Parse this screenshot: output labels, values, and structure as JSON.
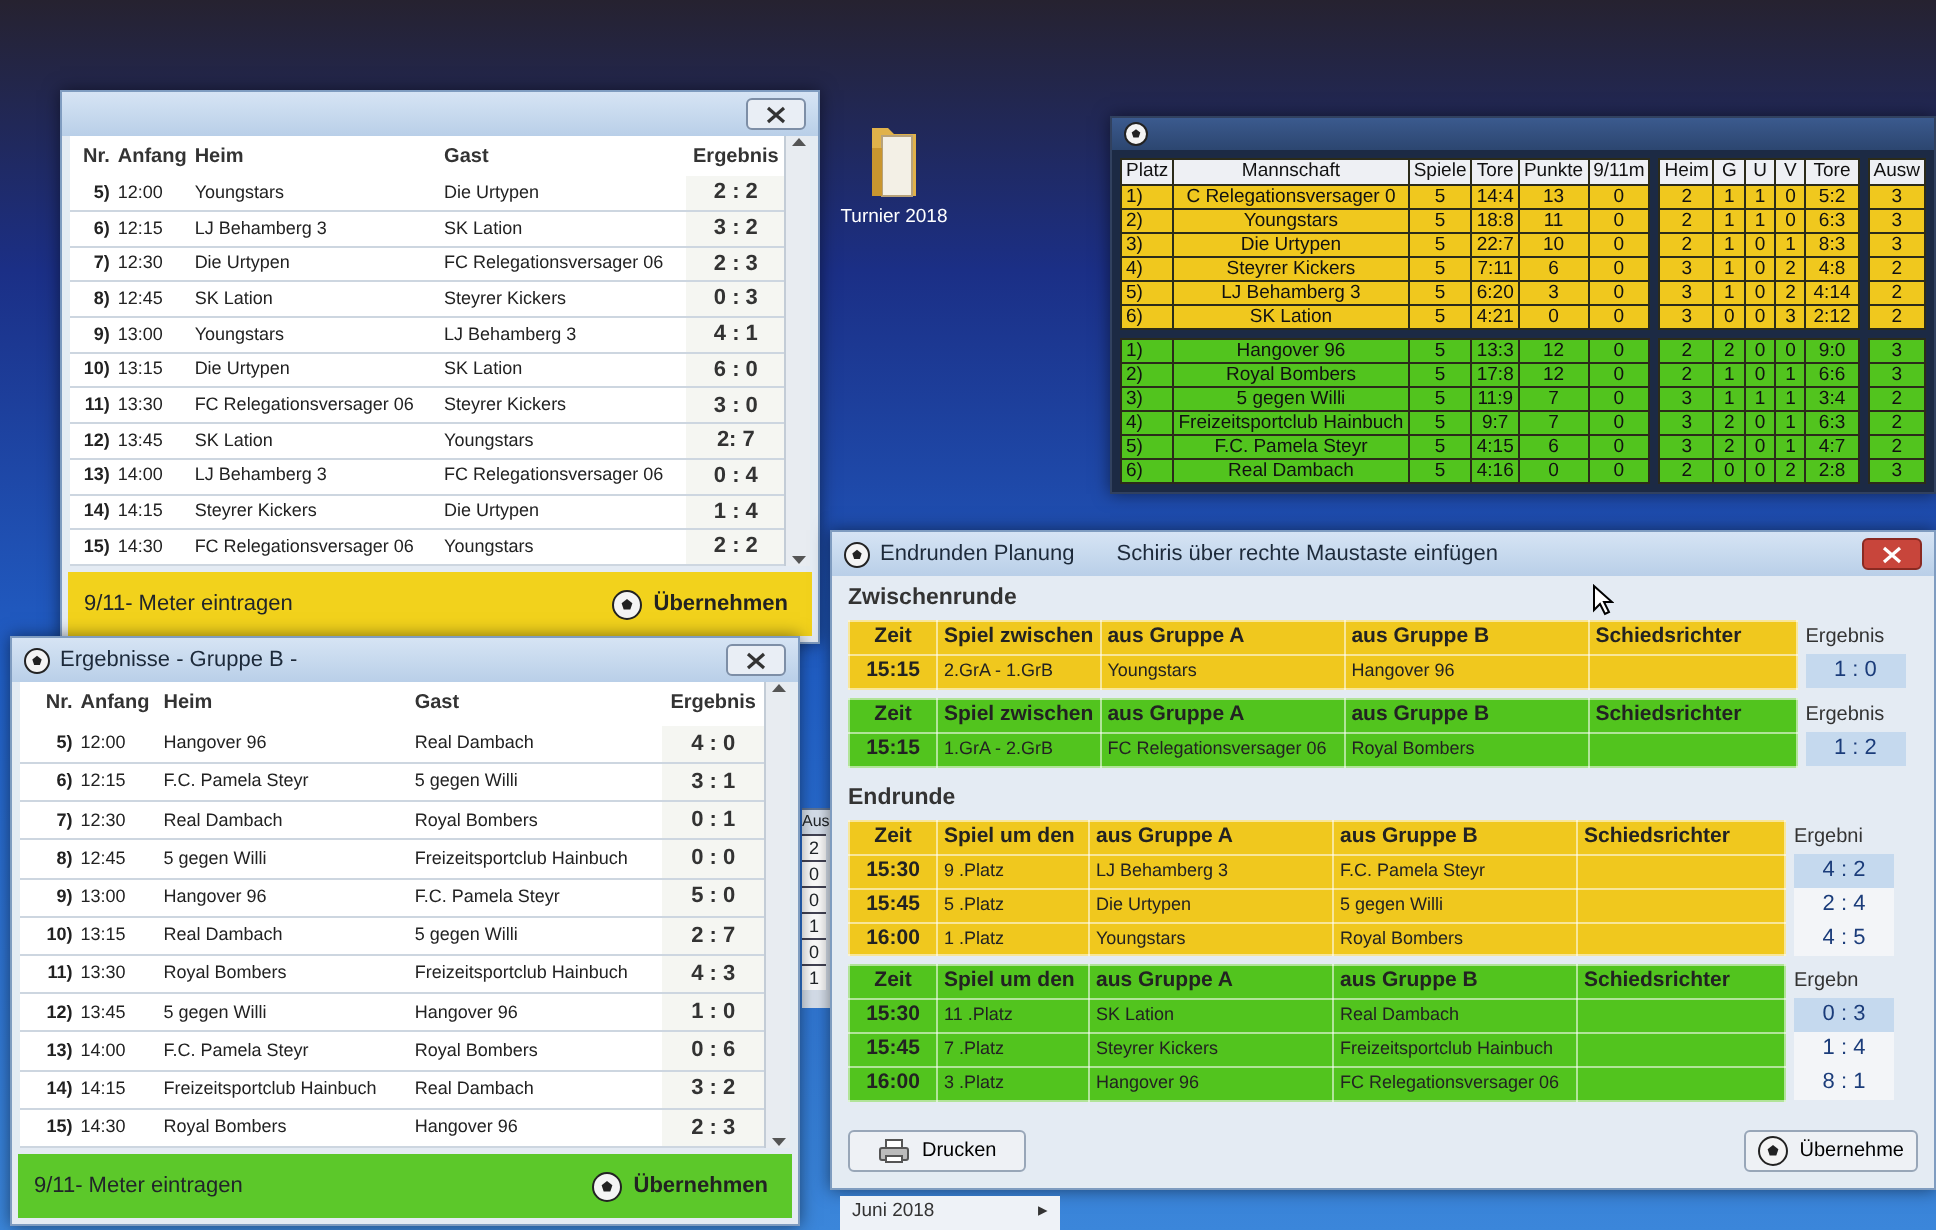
{
  "desktop_icon": {
    "label": "Turnier 2018"
  },
  "result_windows": [
    {
      "color": "#f2d21c",
      "columns": [
        "Nr.",
        "Anfang",
        "Heim",
        "Gast",
        "Ergebnis"
      ],
      "rows": [
        [
          "5)",
          "12:00",
          "Youngstars",
          "Die Urtypen",
          "2 : 2"
        ],
        [
          "6)",
          "12:15",
          "LJ Behamberg 3",
          "SK Lation",
          "3 : 2"
        ],
        [
          "7)",
          "12:30",
          "Die Urtypen",
          "FC Relegationsversager 06",
          "2 : 3"
        ],
        [
          "8)",
          "12:45",
          "SK Lation",
          "Steyrer Kickers",
          "0 : 3"
        ],
        [
          "9)",
          "13:00",
          "Youngstars",
          "LJ Behamberg 3",
          "4 : 1"
        ],
        [
          "10)",
          "13:15",
          "Die Urtypen",
          "SK Lation",
          "6 : 0"
        ],
        [
          "11)",
          "13:30",
          "FC Relegationsversager 06",
          "Steyrer Kickers",
          "3 : 0"
        ],
        [
          "12)",
          "13:45",
          "SK Lation",
          "Youngstars",
          "2: 7"
        ],
        [
          "13)",
          "14:00",
          "LJ Behamberg 3",
          "FC Relegationsversager 06",
          "0 : 4"
        ],
        [
          "14)",
          "14:15",
          "Steyrer Kickers",
          "Die Urtypen",
          "1 : 4"
        ],
        [
          "15)",
          "14:30",
          "FC Relegationsversager 06",
          "Youngstars",
          "2 : 2"
        ]
      ],
      "footer_label": "9/11- Meter eintragen",
      "button": "Übernehmen"
    },
    {
      "title": "Ergebnisse - Gruppe B -",
      "color": "#5cc82a",
      "columns": [
        "Nr.",
        "Anfang",
        "Heim",
        "Gast",
        "Ergebnis"
      ],
      "rows": [
        [
          "5)",
          "12:00",
          "Hangover 96",
          "Real Dambach",
          "4 : 0"
        ],
        [
          "6)",
          "12:15",
          "F.C. Pamela Steyr",
          "5 gegen Willi",
          "3 : 1"
        ],
        [
          "7)",
          "12:30",
          "Real Dambach",
          "Royal Bombers",
          "0 : 1"
        ],
        [
          "8)",
          "12:45",
          "5 gegen Willi",
          "Freizeitsportclub Hainbuch",
          "0 : 0"
        ],
        [
          "9)",
          "13:00",
          "Hangover 96",
          "F.C. Pamela Steyr",
          "5 : 0"
        ],
        [
          "10)",
          "13:15",
          "Real Dambach",
          "5 gegen Willi",
          "2 : 7"
        ],
        [
          "11)",
          "13:30",
          "Royal Bombers",
          "Freizeitsportclub Hainbuch",
          "4 : 3"
        ],
        [
          "12)",
          "13:45",
          "5 gegen Willi",
          "Hangover 96",
          "1 : 0"
        ],
        [
          "13)",
          "14:00",
          "F.C. Pamela Steyr",
          "Royal Bombers",
          "0 : 6"
        ],
        [
          "14)",
          "14:15",
          "Freizeitsportclub Hainbuch",
          "Real Dambach",
          "3 : 2"
        ],
        [
          "15)",
          "14:30",
          "Royal Bombers",
          "Hangover 96",
          "2 : 3"
        ]
      ],
      "footer_label": "9/11- Meter eintragen",
      "button": "Übernehmen"
    }
  ],
  "standings": {
    "columns_main": [
      "Platz",
      "Mannschaft",
      "Spiele",
      "Tore",
      "Punkte",
      "9/11m"
    ],
    "columns_home": [
      "Heim",
      "G",
      "U",
      "V",
      "Tore"
    ],
    "columns_away": [
      "Ausw"
    ],
    "groups": [
      {
        "color": "#f0c81e",
        "rows": [
          {
            "main": [
              "1)",
              "C Relegationsversager 0",
              "5",
              "14:4",
              "13",
              "0"
            ],
            "home": [
              "2",
              "1",
              "1",
              "0",
              "5:2"
            ],
            "away": "3"
          },
          {
            "main": [
              "2)",
              "Youngstars",
              "5",
              "18:8",
              "11",
              "0"
            ],
            "home": [
              "2",
              "1",
              "1",
              "0",
              "6:3"
            ],
            "away": "3"
          },
          {
            "main": [
              "3)",
              "Die Urtypen",
              "5",
              "22:7",
              "10",
              "0"
            ],
            "home": [
              "2",
              "1",
              "0",
              "1",
              "8:3"
            ],
            "away": "3"
          },
          {
            "main": [
              "4)",
              "Steyrer Kickers",
              "5",
              "7:11",
              "6",
              "0"
            ],
            "home": [
              "3",
              "1",
              "0",
              "2",
              "4:8"
            ],
            "away": "2"
          },
          {
            "main": [
              "5)",
              "LJ Behamberg 3",
              "5",
              "6:20",
              "3",
              "0"
            ],
            "home": [
              "3",
              "1",
              "0",
              "2",
              "4:14"
            ],
            "away": "2"
          },
          {
            "main": [
              "6)",
              "SK Lation",
              "5",
              "4:21",
              "0",
              "0"
            ],
            "home": [
              "3",
              "0",
              "0",
              "3",
              "2:12"
            ],
            "away": "2"
          }
        ]
      },
      {
        "color": "#52c41e",
        "rows": [
          {
            "main": [
              "1)",
              "Hangover 96",
              "5",
              "13:3",
              "12",
              "0"
            ],
            "home": [
              "2",
              "2",
              "0",
              "0",
              "9:0"
            ],
            "away": "3"
          },
          {
            "main": [
              "2)",
              "Royal Bombers",
              "5",
              "17:8",
              "12",
              "0"
            ],
            "home": [
              "2",
              "1",
              "0",
              "1",
              "6:6"
            ],
            "away": "3"
          },
          {
            "main": [
              "3)",
              "5 gegen Willi",
              "5",
              "11:9",
              "7",
              "0"
            ],
            "home": [
              "3",
              "1",
              "1",
              "1",
              "3:4"
            ],
            "away": "2"
          },
          {
            "main": [
              "4)",
              "Freizeitsportclub Hainbuch",
              "5",
              "9:7",
              "7",
              "0"
            ],
            "home": [
              "3",
              "2",
              "0",
              "1",
              "6:3"
            ],
            "away": "2"
          },
          {
            "main": [
              "5)",
              "F.C. Pamela Steyr",
              "5",
              "4:15",
              "6",
              "0"
            ],
            "home": [
              "3",
              "2",
              "0",
              "1",
              "4:7"
            ],
            "away": "2"
          },
          {
            "main": [
              "6)",
              "Real Dambach",
              "5",
              "4:16",
              "0",
              "0"
            ],
            "home": [
              "2",
              "0",
              "0",
              "2",
              "2:8"
            ],
            "away": "3"
          }
        ]
      }
    ]
  },
  "background_window": {
    "header": "Aus",
    "values": [
      "2",
      "0",
      "0",
      "1",
      "0",
      "1"
    ]
  },
  "final_planning": {
    "title": "Endrunden Planung",
    "hint": "Schiris über rechte Maustaste einfügen",
    "sections": [
      {
        "label": "Zwischenrunde",
        "blocks": [
          {
            "color": "#f0c81e",
            "columns": [
              "Zeit",
              "Spiel zwischen",
              "aus Gruppe A",
              "aus Gruppe B",
              "Schiedsrichter"
            ],
            "rows": [
              [
                "15:15",
                "2.GrA - 1.GrB",
                "Youngstars",
                "Hangover 96"
              ]
            ],
            "result_header": "Ergebnis",
            "results": [
              {
                "score": "1 : 0",
                "selected": true
              }
            ]
          },
          {
            "color": "#52c41e",
            "columns": [
              "Zeit",
              "Spiel zwischen",
              "aus Gruppe A",
              "aus Gruppe B",
              "Schiedsrichter"
            ],
            "rows": [
              [
                "15:15",
                "1.GrA - 2.GrB",
                "FC Relegationsversager 06",
                "Royal Bombers"
              ]
            ],
            "result_header": "Ergebnis",
            "results": [
              {
                "score": "1 : 2",
                "selected": true
              }
            ]
          }
        ]
      },
      {
        "label": "Endrunde",
        "blocks": [
          {
            "color": "#f0c81e",
            "columns": [
              "Zeit",
              "Spiel um den",
              "aus Gruppe A",
              "aus Gruppe B",
              "Schiedsrichter"
            ],
            "rows": [
              [
                "15:30",
                "9 .Platz",
                "LJ Behamberg 3",
                "F.C. Pamela Steyr"
              ],
              [
                "15:45",
                "5 .Platz",
                "Die Urtypen",
                "5 gegen Willi"
              ],
              [
                "16:00",
                "1 .Platz",
                "Youngstars",
                "Royal Bombers"
              ]
            ],
            "result_header": "Ergebni",
            "results": [
              {
                "score": "4 : 2",
                "selected": true
              },
              {
                "score": "2 : 4",
                "selected": false
              },
              {
                "score": "4 : 5",
                "selected": false
              }
            ]
          },
          {
            "color": "#52c41e",
            "columns": [
              "Zeit",
              "Spiel um den",
              "aus Gruppe A",
              "aus Gruppe B",
              "Schiedsrichter"
            ],
            "rows": [
              [
                "15:30",
                "11 .Platz",
                "SK Lation",
                "Real Dambach"
              ],
              [
                "15:45",
                "7 .Platz",
                "Steyrer Kickers",
                "Freizeitsportclub Hainbuch"
              ],
              [
                "16:00",
                "3 .Platz",
                "Hangover 96",
                "FC Relegationsversager 06"
              ]
            ],
            "result_header": "Ergebn",
            "results": [
              {
                "score": "0 : 3",
                "selected": true
              },
              {
                "score": "1 : 4",
                "selected": false
              },
              {
                "score": "8 : 1",
                "selected": false
              }
            ]
          }
        ]
      }
    ],
    "print_button": "Drucken",
    "apply_button": "Übernehme"
  },
  "calendar_item": {
    "label": "Juni 2018",
    "arrow": "▸"
  }
}
